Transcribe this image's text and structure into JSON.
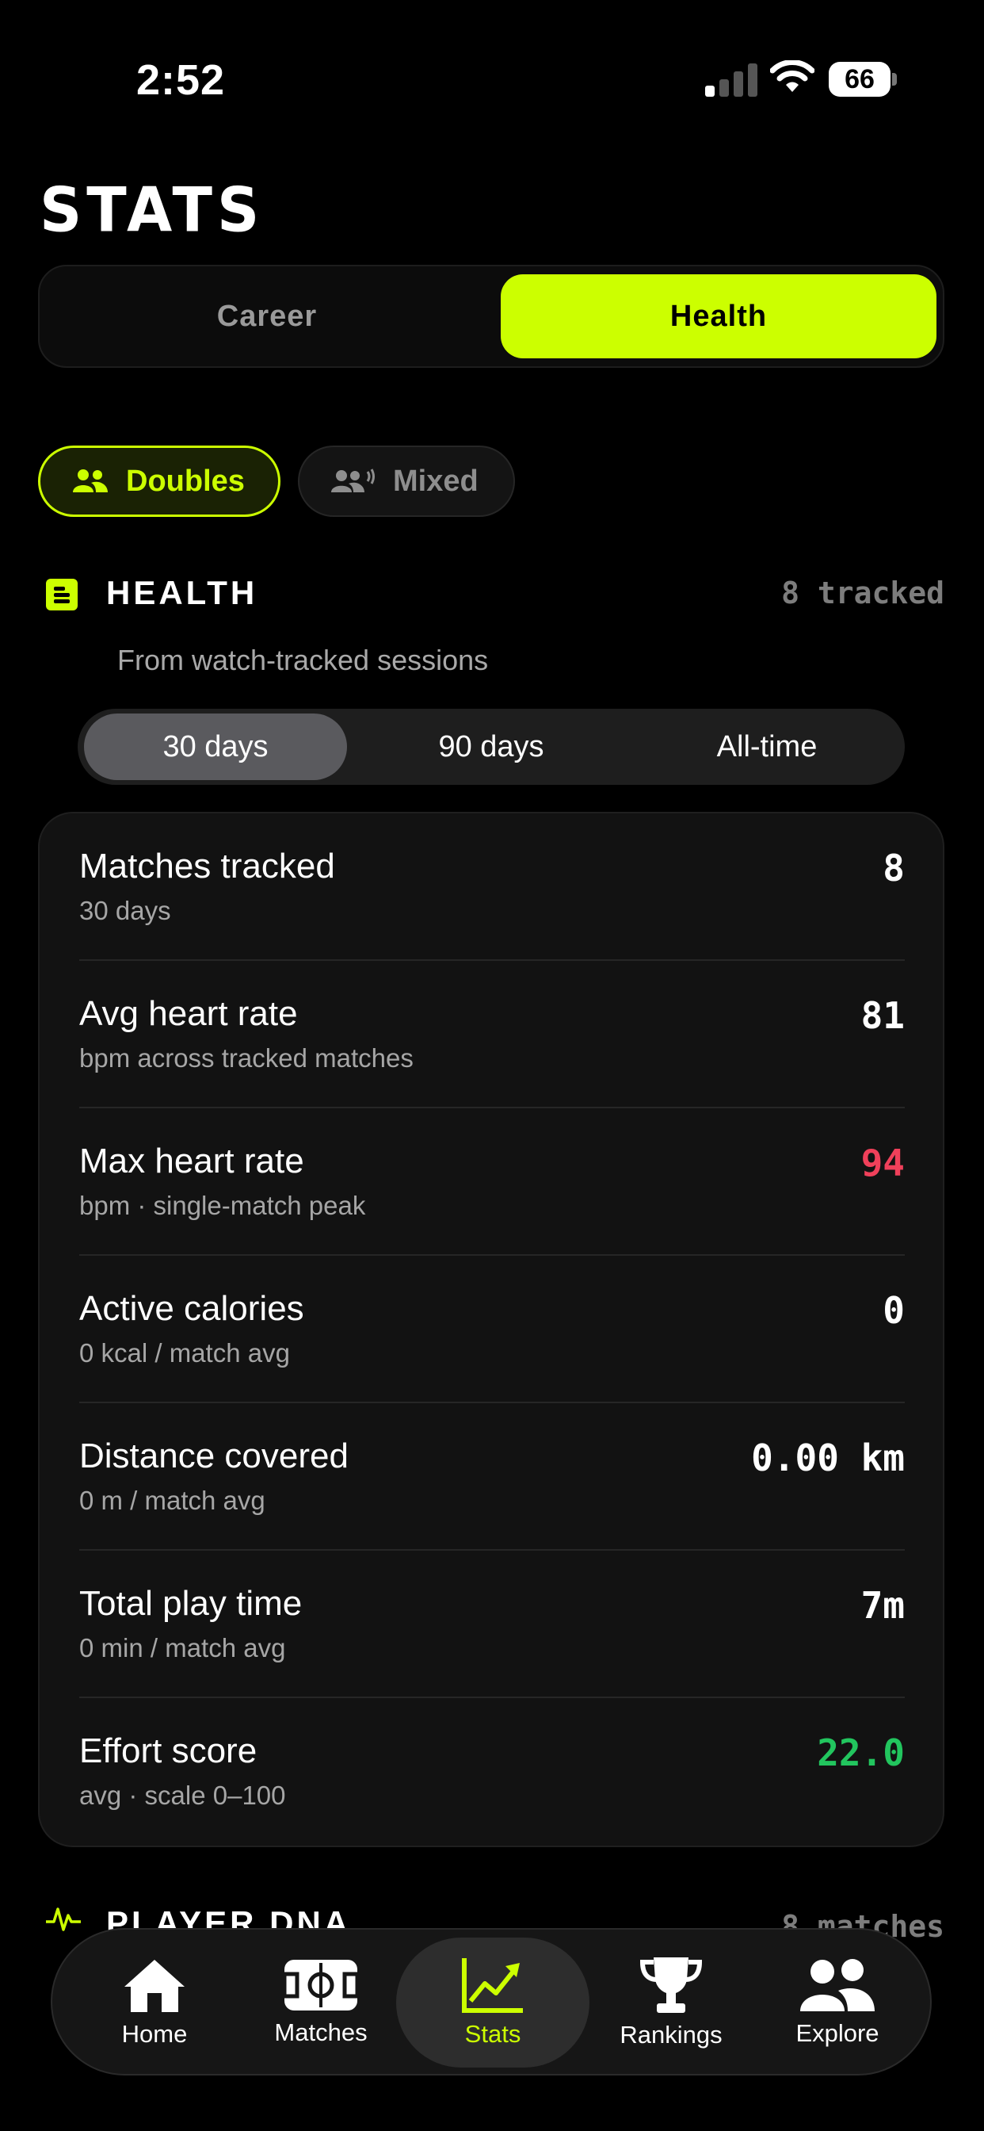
{
  "status_bar": {
    "time": "2:52",
    "battery": "66"
  },
  "page": {
    "title": "STATS"
  },
  "main_tabs": [
    {
      "label": "Career",
      "active": false
    },
    {
      "label": "Health",
      "active": true
    }
  ],
  "modes": [
    {
      "label": "Doubles",
      "active": true
    },
    {
      "label": "Mixed",
      "active": false
    }
  ],
  "health": {
    "title": "HEALTH",
    "count": "8 tracked",
    "subtitle": "From watch-tracked sessions",
    "ranges": [
      {
        "label": "30 days",
        "active": true
      },
      {
        "label": "90 days",
        "active": false
      },
      {
        "label": "All-time",
        "active": false
      }
    ],
    "stats": [
      {
        "label": "Matches tracked",
        "sub": "30 days",
        "value": "8",
        "color": "#ffffff"
      },
      {
        "label": "Avg heart rate",
        "sub": "bpm across tracked matches",
        "value": "81",
        "color": "#ffffff"
      },
      {
        "label": "Max heart rate",
        "sub": "bpm · single-match peak",
        "value": "94",
        "color": "#f0405a"
      },
      {
        "label": "Active calories",
        "sub": "0 kcal / match avg",
        "value": "0",
        "color": "#ffffff"
      },
      {
        "label": "Distance covered",
        "sub": "0 m / match avg",
        "value": "0.00 km",
        "color": "#ffffff"
      },
      {
        "label": "Total play time",
        "sub": "0 min / match avg",
        "value": "7m",
        "color": "#ffffff"
      },
      {
        "label": "Effort score",
        "sub": "avg · scale 0–100",
        "value": "22.0",
        "color": "#22c55e"
      }
    ]
  },
  "player_dna": {
    "title": "PLAYER DNA",
    "count": "8 matches"
  },
  "nav": [
    {
      "label": "Home",
      "icon": "home-icon",
      "active": false
    },
    {
      "label": "Matches",
      "icon": "court-icon",
      "active": false
    },
    {
      "label": "Stats",
      "icon": "chart-icon",
      "active": true
    },
    {
      "label": "Rankings",
      "icon": "trophy-icon",
      "active": false
    },
    {
      "label": "Explore",
      "icon": "people-icon",
      "active": false
    }
  ],
  "colors": {
    "accent": "#ccff00",
    "background": "#000000",
    "card": "#121212"
  }
}
